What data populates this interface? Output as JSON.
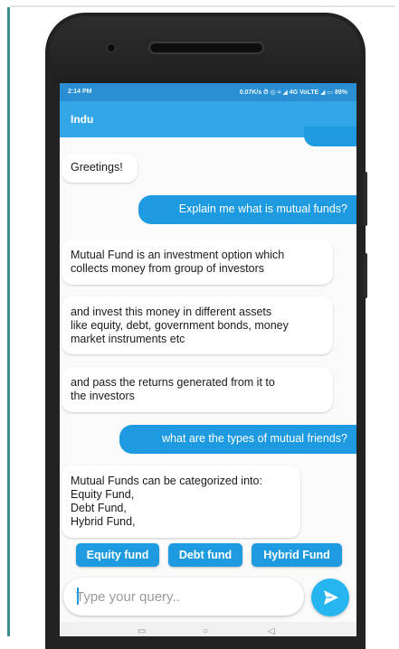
{
  "status_bar": {
    "time": "2:14 PM",
    "right": "0.07K/s ⏱ ◎ ≈ ◢ 4G VoLTE ◢ ▭ 89%"
  },
  "app_bar": {
    "title": "Indu"
  },
  "messages": [
    {
      "sender": "user",
      "text": ""
    },
    {
      "sender": "bot",
      "text": "Greetings!"
    },
    {
      "sender": "user",
      "text": "Explain me what is mutual funds?"
    },
    {
      "sender": "bot",
      "text": "Mutual Fund is an investment option which\ncollects money from group of investors"
    },
    {
      "sender": "bot",
      "text": "and invest this money in different assets\nlike equity, debt, government bonds, money\nmarket instruments etc"
    },
    {
      "sender": "bot",
      "text": "and pass the returns generated from it to\nthe investors"
    },
    {
      "sender": "user",
      "text": "what are the types of mutual friends?"
    },
    {
      "sender": "bot",
      "text": "Mutual Funds can be categorized into:\nEquity Fund,\nDebt Fund,\nHybrid Fund,"
    }
  ],
  "quick_replies": [
    "Equity fund",
    "Debt fund",
    "Hybrid Fund"
  ],
  "composer": {
    "placeholder": "Type your query.."
  },
  "colors": {
    "accent": "#33a6e8",
    "bubble_user": "#1e9be0",
    "send_button": "#27b5f0"
  },
  "icons": {
    "send": "send-icon",
    "back": "nav-back-icon",
    "home": "nav-home-icon",
    "recent": "nav-recent-icon"
  }
}
